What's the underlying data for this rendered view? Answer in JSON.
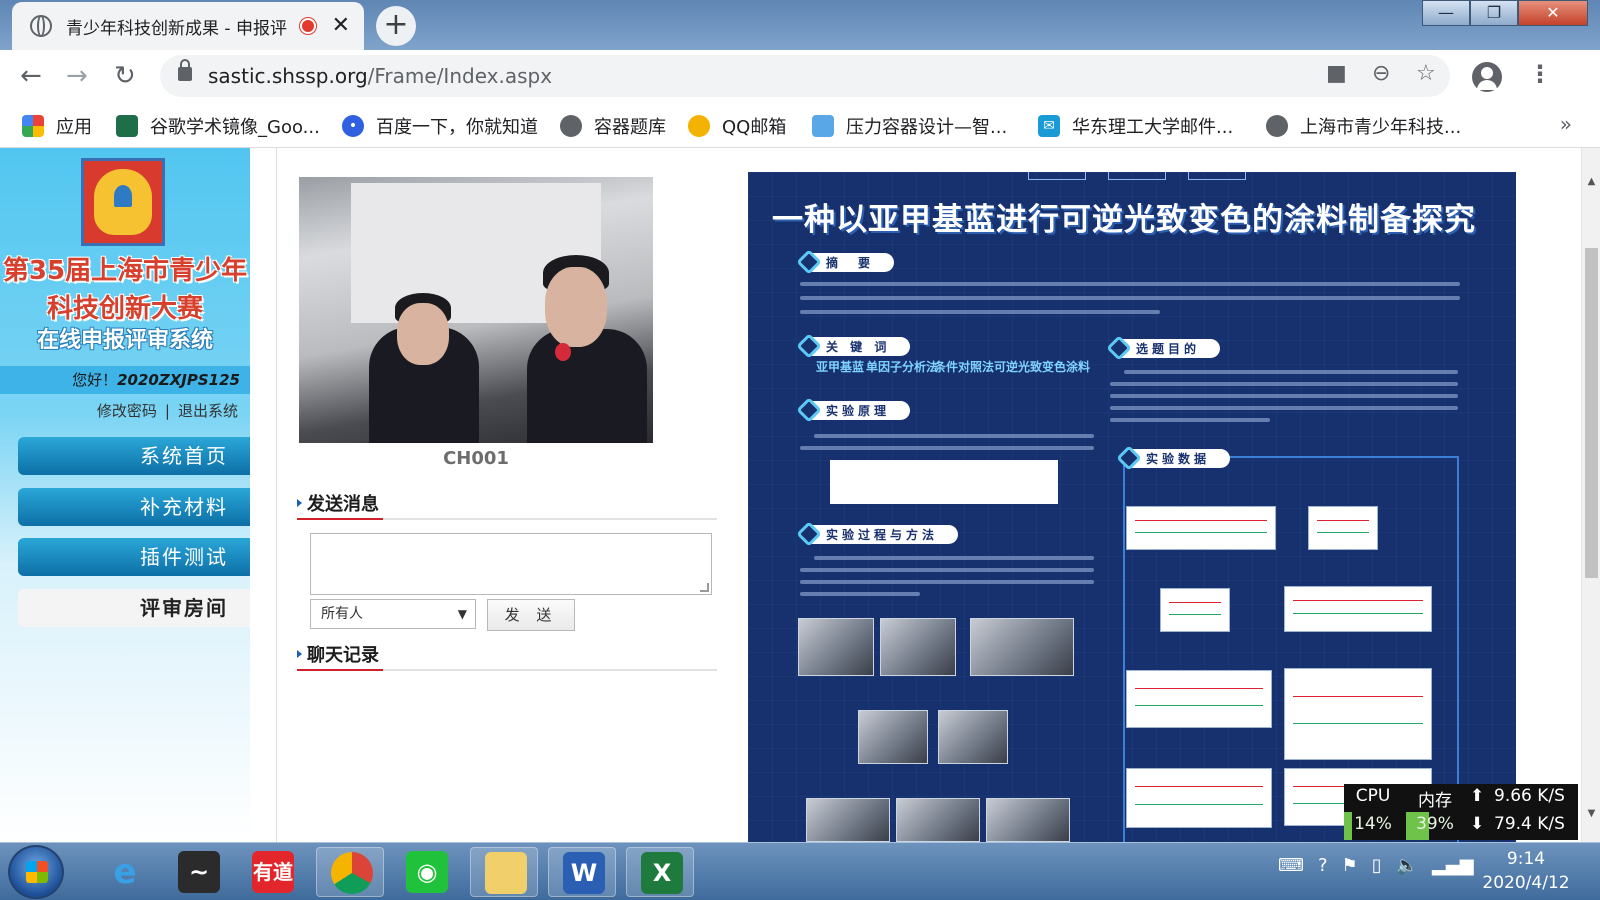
{
  "tab": {
    "title": "青少年科技创新成果 - 申报评",
    "close": "✕",
    "new_tab": "+"
  },
  "window": {
    "minimize": "—",
    "maximize": "❐",
    "close": "✕"
  },
  "address": {
    "host": "sastic.shssp.org",
    "path": "/Frame/Index.aspx"
  },
  "nav": {
    "back": "←",
    "forward": "→",
    "reload": "↻",
    "menu": "⋮",
    "more": "»"
  },
  "bookmarks": [
    {
      "label": "应用",
      "icon": "apps-grid-icon",
      "color": "#ea4335"
    },
    {
      "label": "谷歌学术镜像_Goo...",
      "icon": "book-icon",
      "color": "#1e6e4a"
    },
    {
      "label": "百度一下，你就知道",
      "icon": "baidu-paw-icon",
      "color": "#3060e0"
    },
    {
      "label": "容器题库",
      "icon": "globe-icon",
      "color": "#5f6368"
    },
    {
      "label": "QQ邮箱",
      "icon": "qq-mail-icon",
      "color": "#f3b300"
    },
    {
      "label": "压力容器设计—智...",
      "icon": "bars-icon",
      "color": "#5aa7e8"
    },
    {
      "label": "华东理工大学邮件...",
      "icon": "mail-icon",
      "color": "#1a9bd6"
    },
    {
      "label": "上海市青少年科技...",
      "icon": "globe-icon",
      "color": "#5f6368"
    }
  ],
  "sidebar": {
    "title_line1": "第35届上海市青少年",
    "title_line2": "科技创新大赛",
    "title_line3": "在线申报评审系统",
    "greeting": "您好！",
    "user_id": "2020ZXJPS125",
    "change_password": "修改密码",
    "separator": "|",
    "logout": "退出系统",
    "menu": [
      {
        "label": "系统首页",
        "active": false
      },
      {
        "label": "补充材料",
        "active": false
      },
      {
        "label": "插件测试",
        "active": false
      },
      {
        "label": "评审房间",
        "active": true
      }
    ]
  },
  "room": {
    "camera_label": "CH001",
    "send_section": "发送消息",
    "recipient": "所有人",
    "send_button": "发 送",
    "chat_section": "聊天记录"
  },
  "poster": {
    "title": "一种以亚甲基蓝进行可逆光致变色的涂料制备探究",
    "sections": [
      "摘　要",
      "关 键 词",
      "实验原理",
      "实验过程与方法",
      "选题目的",
      "实验数据"
    ],
    "keywords": [
      "亚甲基蓝",
      "单因子分析法",
      "条件对照法",
      "可逆光致变色涂料"
    ]
  },
  "monitor": {
    "cpu_label": "CPU",
    "mem_label": "内存",
    "cpu_value": "14%",
    "mem_value": "39%",
    "cpu_percent": 14,
    "mem_percent": 39,
    "up_speed": "9.66 K/S",
    "down_speed": "79.4 K/S"
  },
  "taskbar": {
    "apps": [
      {
        "name": "ie",
        "icon": "ie-icon",
        "open": false
      },
      {
        "name": "bird",
        "icon": "bird-app-icon",
        "open": false
      },
      {
        "name": "youdao",
        "icon": "youdao-icon",
        "label": "有道",
        "open": false
      },
      {
        "name": "chrome",
        "icon": "chrome-icon",
        "open": true
      },
      {
        "name": "wifi",
        "icon": "wifi-share-icon",
        "open": false
      },
      {
        "name": "explorer",
        "icon": "folder-icon",
        "open": true
      },
      {
        "name": "word",
        "icon": "word-icon",
        "label": "W",
        "open": true
      },
      {
        "name": "excel",
        "icon": "excel-icon",
        "label": "X",
        "open": true
      }
    ],
    "time": "9:14",
    "date": "2020/4/12"
  }
}
